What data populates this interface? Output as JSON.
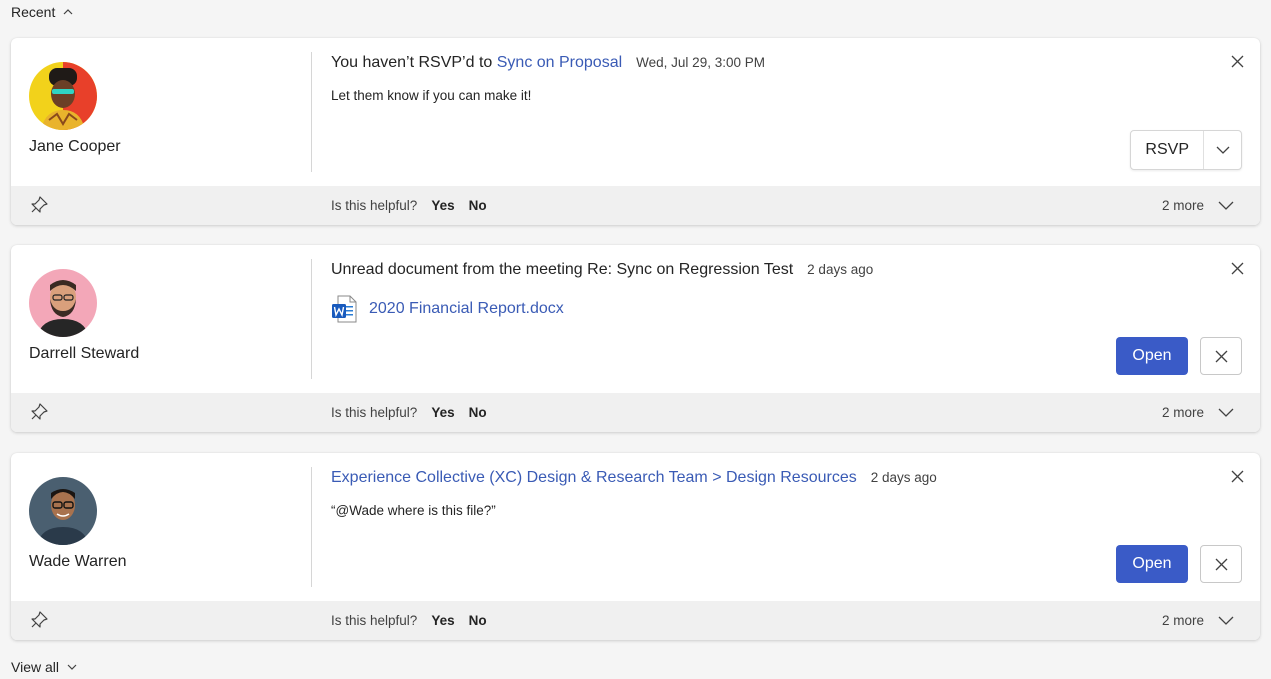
{
  "section": {
    "label": "Recent",
    "view_all": "View all"
  },
  "feedback": {
    "question": "Is this helpful?",
    "yes": "Yes",
    "no": "No",
    "more": "2 more"
  },
  "cards": [
    {
      "person": "Jane Cooper",
      "title_prefix": "You haven’t RSVP’d to ",
      "title_link": "Sync on Proposal",
      "timestamp": "Wed, Jul 29, 3:00 PM",
      "body": "Let them know if you can make it!",
      "action": "RSVP"
    },
    {
      "person": "Darrell Steward",
      "title": "Unread document from the meeting Re: Sync on Regression Test",
      "timestamp": "2 days ago",
      "document": "2020 Financial Report.docx",
      "action": "Open"
    },
    {
      "person": "Wade Warren",
      "title_link": "Experience Collective (XC) Design & Research Team > Design Resources",
      "timestamp": "2 days ago",
      "body": "“@Wade where is this file?”",
      "action": "Open"
    }
  ],
  "colors": {
    "accent": "#3a5bc7",
    "link": "#3a5bb5",
    "footer_bg": "#f0f0f0",
    "page_bg": "#f5f5f5"
  }
}
